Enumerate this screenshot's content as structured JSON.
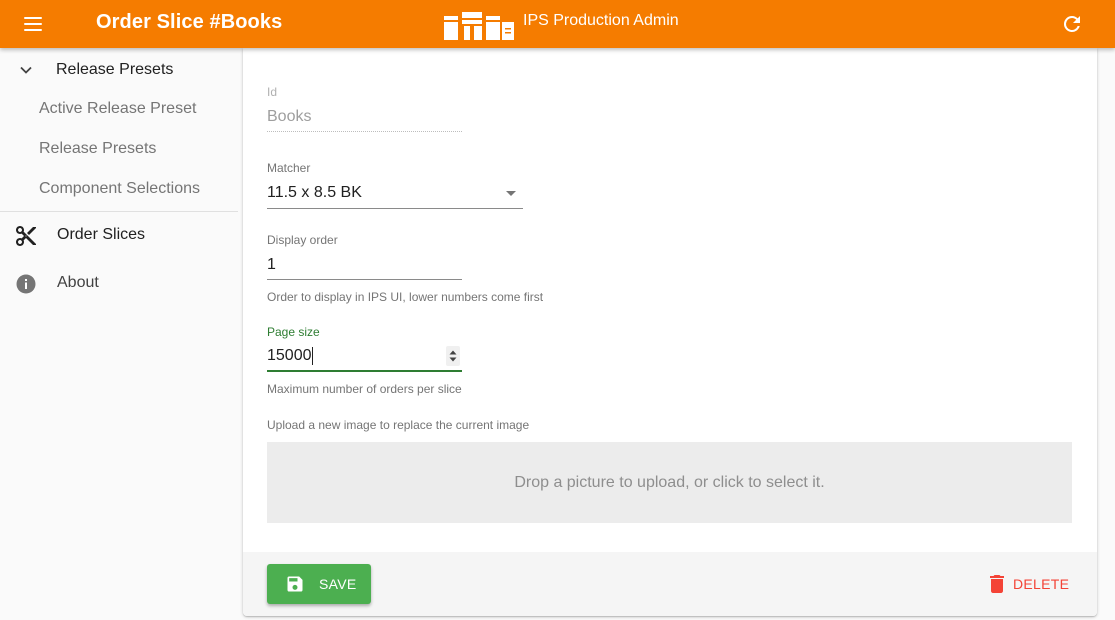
{
  "appbar": {
    "title": "Order Slice #Books",
    "brand_name": "IPS Production Admin",
    "menu_icon": "menu-icon",
    "refresh_icon": "refresh-icon",
    "color": "#f57c00"
  },
  "sidebar": {
    "group": {
      "label": "Release Presets",
      "icon": "chevron-down-icon",
      "expanded": true
    },
    "sub_items": [
      {
        "label": "Active Release Preset"
      },
      {
        "label": "Release Presets"
      },
      {
        "label": "Component Selections"
      }
    ],
    "items": [
      {
        "label": "Order Slices",
        "icon": "scissors-icon"
      },
      {
        "label": "About",
        "icon": "info-icon"
      }
    ]
  },
  "form": {
    "id": {
      "label": "Id",
      "value": "Books",
      "disabled": true
    },
    "matcher": {
      "label": "Matcher",
      "value": "11.5 x 8.5 BK"
    },
    "display_order": {
      "label": "Display order",
      "value": "1",
      "helper": "Order to display in IPS UI, lower numbers come first"
    },
    "page_size": {
      "label": "Page size",
      "value": "15000",
      "helper": "Maximum number of orders per slice",
      "focused": true
    },
    "image": {
      "helper": "Upload a new image to replace the current image",
      "dropzone_text": "Drop a picture to upload, or click to select it."
    }
  },
  "toolbar": {
    "save_label": "SAVE",
    "delete_label": "DELETE",
    "save_color": "#4caf50",
    "delete_color": "#f44336"
  }
}
